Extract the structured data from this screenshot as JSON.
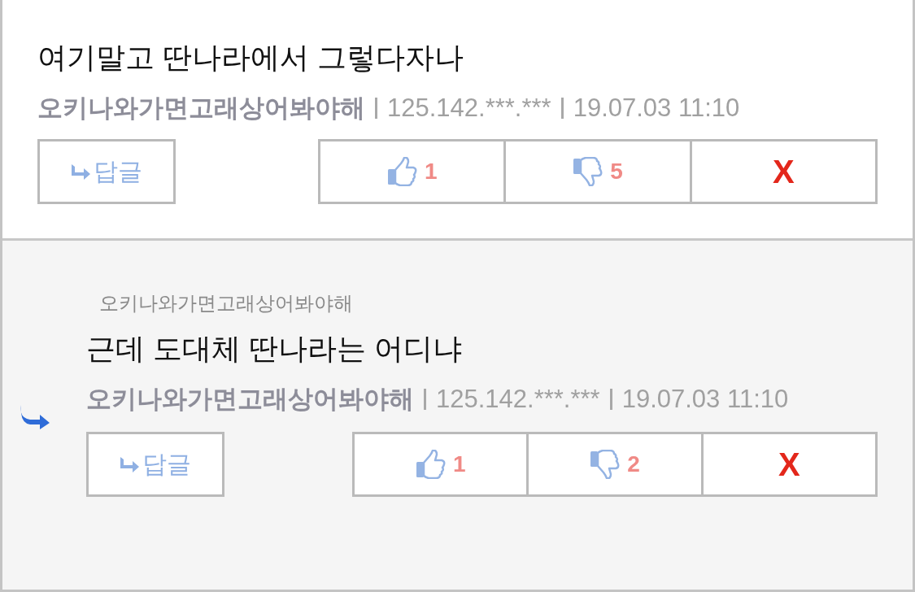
{
  "comments": [
    {
      "kind": "comment",
      "body": "여기말고 딴나라에서 그렇다자나",
      "author": "오키나와가면고래상어봐야해",
      "ip": "125.142.***.***",
      "date": "19.07.03 11:10",
      "reply_label": "답글",
      "likes": "1",
      "dislikes": "5",
      "delete_label": "X"
    },
    {
      "kind": "reply",
      "reply_to": "오키나와가면고래상어봐야해",
      "body": "근데 도대체 딴나라는 어디냐",
      "author": "오키나와가면고래상어봐야해",
      "ip": "125.142.***.***",
      "date": "19.07.03 11:10",
      "reply_label": "답글",
      "likes": "1",
      "dislikes": "2",
      "delete_label": "X"
    }
  ]
}
